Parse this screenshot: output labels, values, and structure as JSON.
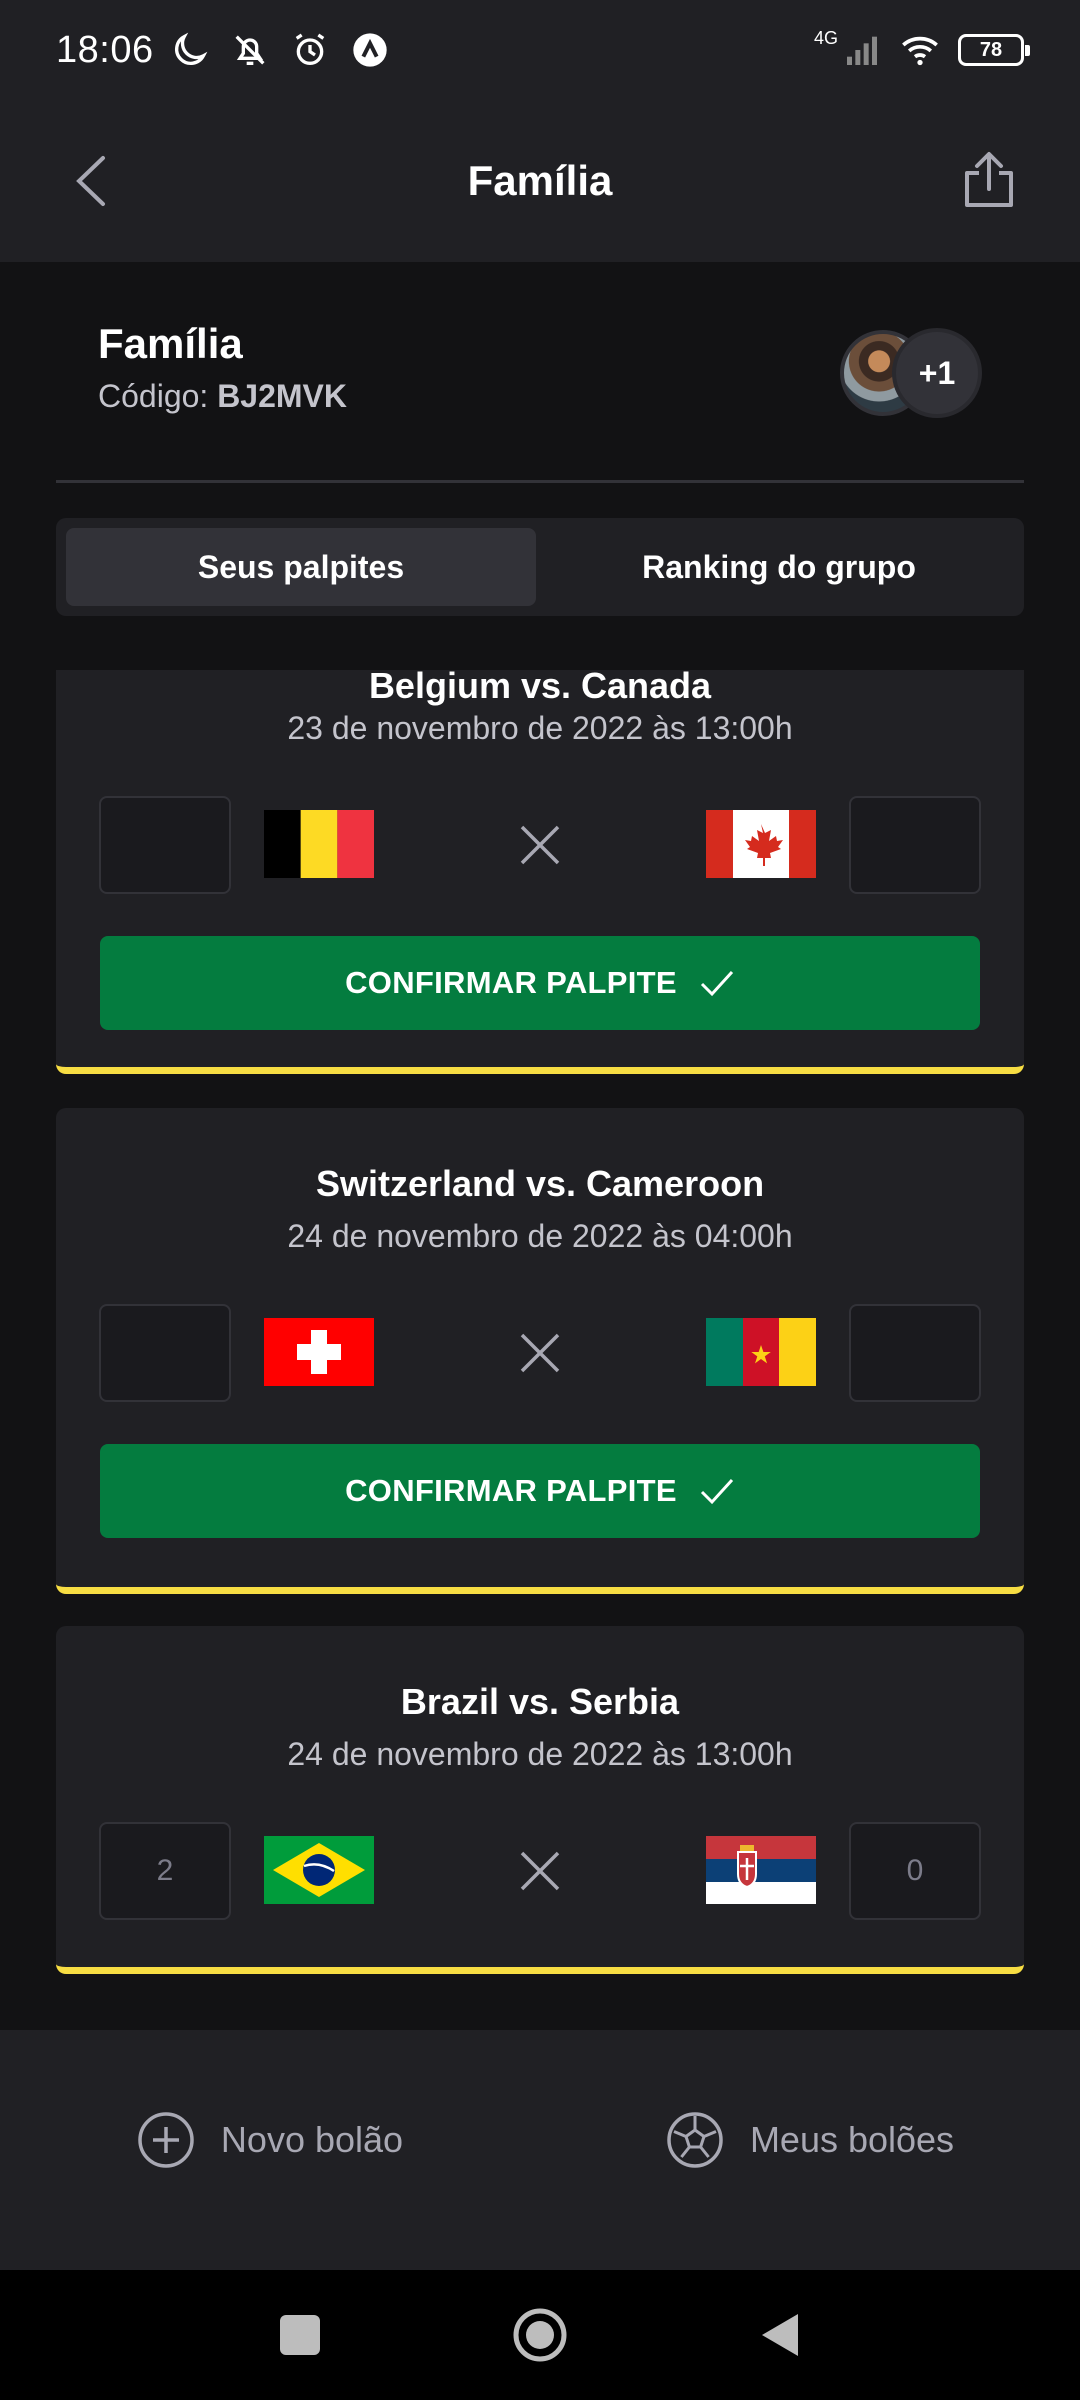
{
  "status_bar": {
    "time": "18:06",
    "network": "4G",
    "battery": "78"
  },
  "app_bar": {
    "title": "Família"
  },
  "group": {
    "name": "Família",
    "code_label": "Código:",
    "code": "BJ2MVK",
    "members_more": "+1"
  },
  "tabs": [
    {
      "label": "Seus palpites",
      "active": true
    },
    {
      "label": "Ranking do grupo",
      "active": false
    }
  ],
  "matches": [
    {
      "title": "Belgium vs. Canada",
      "date": "23 de novembro de 2022 às 13:00h",
      "home_flag": "belgium-flag",
      "away_flag": "canada-flag",
      "home_score": "",
      "away_score": "",
      "confirm_label": "CONFIRMAR PALPITE"
    },
    {
      "title": "Switzerland vs. Cameroon",
      "date": "24 de novembro de 2022 às 04:00h",
      "home_flag": "switzerland-flag",
      "away_flag": "cameroon-flag",
      "home_score": "",
      "away_score": "",
      "confirm_label": "CONFIRMAR PALPITE"
    },
    {
      "title": "Brazil vs. Serbia",
      "date": "24 de novembro de 2022 às 13:00h",
      "home_flag": "brazil-flag",
      "away_flag": "serbia-flag",
      "home_score": "2",
      "away_score": "0"
    }
  ],
  "bottom_nav": {
    "new_pool": "Novo bolão",
    "my_pools": "Meus bolões"
  },
  "colors": {
    "accent_green": "#047c3f",
    "card_border_yellow": "#f7dd43",
    "surface": "#202024",
    "background": "#121214"
  }
}
